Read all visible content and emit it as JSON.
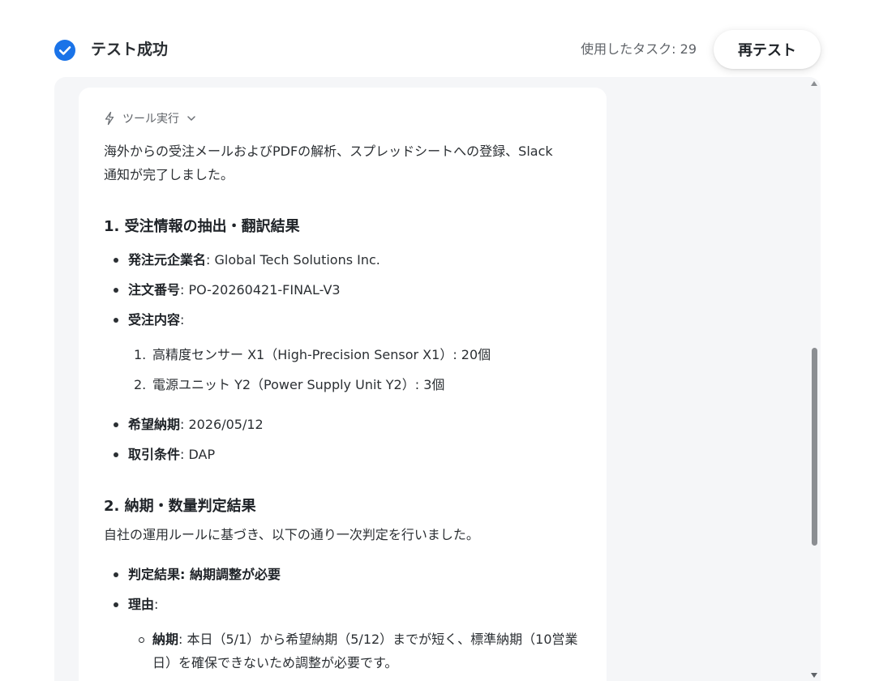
{
  "header": {
    "status_title": "テスト成功",
    "task_usage": "使用したタスク: 29",
    "retest_label": "再テスト"
  },
  "tool": {
    "label": "ツール実行"
  },
  "result": {
    "intro_line1": "海外からの受注メールおよびPDFの解析、スプレッドシートへの登録、Slack",
    "intro_line2": "通知が完了しました。",
    "section1": {
      "title": "1. 受注情報の抽出・翻訳結果",
      "items": [
        {
          "key": "発注元企業名",
          "value": ": Global Tech Solutions Inc."
        },
        {
          "key": "注文番号",
          "value": ": PO-20260421-FINAL-V3"
        },
        {
          "key": "受注内容",
          "value": ":"
        }
      ],
      "orders": [
        {
          "num": "1.",
          "text": "高精度センサー X1（High-Precision Sensor X1）: 20個"
        },
        {
          "num": "2.",
          "text": "電源ユニット Y2（Power Supply Unit Y2）: 3個"
        }
      ],
      "items2": [
        {
          "key": "希望納期",
          "value": ": 2026/05/12"
        },
        {
          "key": "取引条件",
          "value": ": DAP"
        }
      ]
    },
    "section2": {
      "title": "2. 納期・数量判定結果",
      "intro": "自社の運用ルールに基づき、以下の通り一次判定を行いました。",
      "judgement_key": "判定結果",
      "judgement_value": ": 納期調整が必要",
      "reason_key": "理由",
      "reason_value": ":",
      "reasons": [
        {
          "key": "納期",
          "line1": ": 本日（5/1）から希望納期（5/12）までが短く、標準納期（10営業",
          "line2": "日）を確保できないため調整が必要です。"
        }
      ]
    }
  },
  "colors": {
    "accent": "#1a73e8",
    "panel_bg": "#f5f6f8",
    "scroll_thumb": "#8b8e92"
  }
}
